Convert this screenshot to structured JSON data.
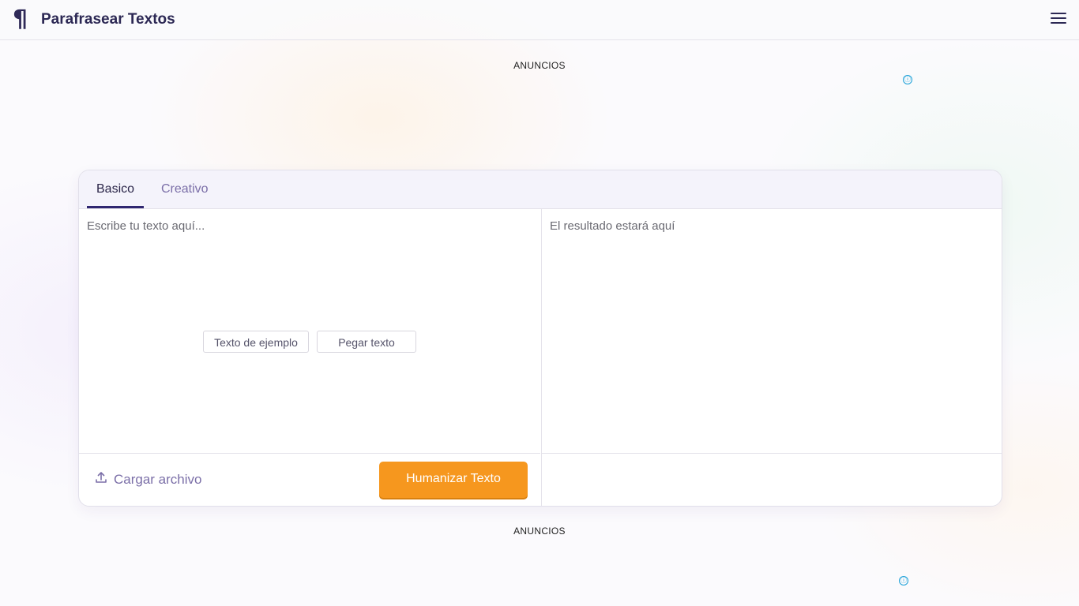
{
  "header": {
    "brand_icon": "pilcrow-icon",
    "title": "Parafrasear Textos",
    "menu_icon": "hamburger-menu-icon"
  },
  "ads": {
    "top_label": "ANUNCIOS",
    "bottom_label": "ANUNCIOS",
    "info_icon": "ⓘ"
  },
  "tabs": [
    {
      "label": "Basico",
      "active": true
    },
    {
      "label": "Creativo",
      "active": false
    }
  ],
  "editor": {
    "input_placeholder": "Escribe tu texto aquí...",
    "output_placeholder": "El resultado estará aquí",
    "sample_button": "Texto de ejemplo",
    "paste_button": "Pegar texto",
    "upload_label": "Cargar archivo",
    "upload_icon": "upload-icon",
    "submit_button": "Humanizar Texto"
  },
  "colors": {
    "brand": "#2c2854",
    "accent": "#f6971e",
    "tab_inactive": "#7b6fa8"
  }
}
